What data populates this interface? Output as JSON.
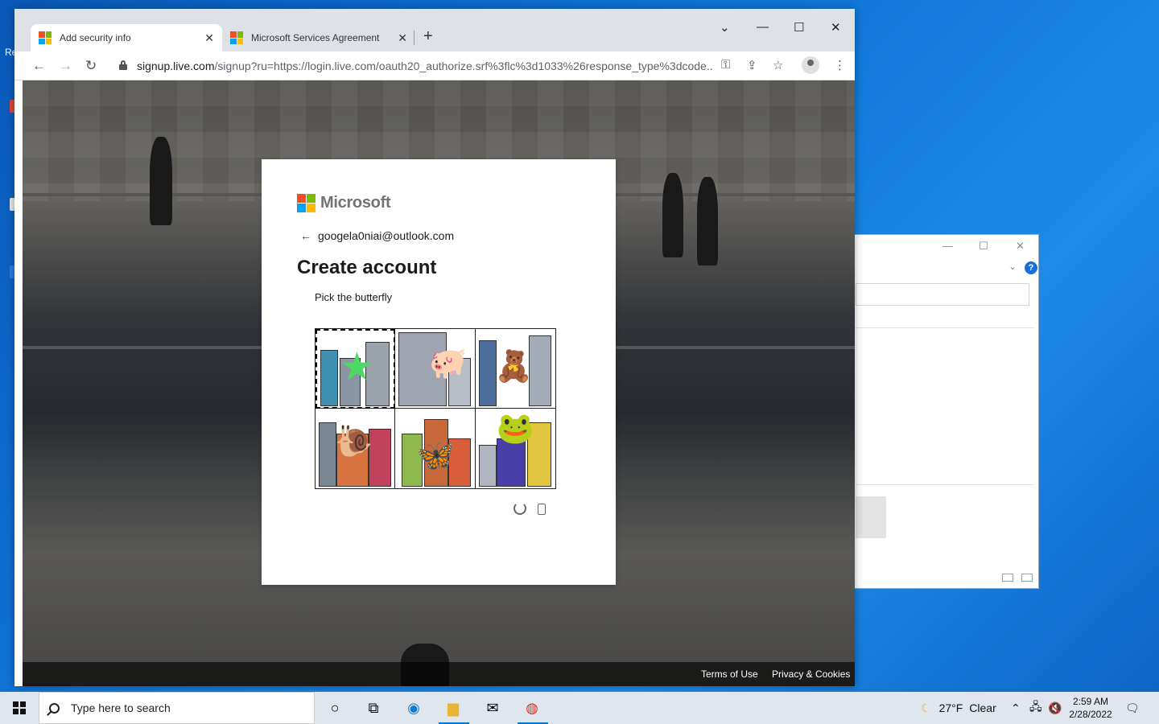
{
  "desktop": {
    "edge_text": "Re"
  },
  "browser": {
    "tabs": [
      {
        "title": "Add security info",
        "active": true
      },
      {
        "title": "Microsoft Services Agreement",
        "active": false
      }
    ],
    "url_host": "signup.live.com",
    "url_rest": "/signup?ru=https://login.live.com/oauth20_authorize.srf%3flc%3d1033%26response_type%3dcode..."
  },
  "card": {
    "brand": "Microsoft",
    "email": "googela0niai@outlook.com",
    "heading": "Create account",
    "instruction": "Pick the butterfly"
  },
  "captcha": {
    "tiles": [
      {
        "subject": "starfish",
        "icon": "★",
        "color": "#4cd964"
      },
      {
        "subject": "pig",
        "icon": "🐖",
        "color": "#f2a0b0"
      },
      {
        "subject": "toy",
        "icon": "🧸",
        "color": "#f5e6a0"
      },
      {
        "subject": "snail",
        "icon": "🐌",
        "color": "#e86f6f"
      },
      {
        "subject": "butterfly",
        "icon": "🦋",
        "color": "#e5c25a"
      },
      {
        "subject": "frog",
        "icon": "🐸",
        "color": "#6fcf4a"
      }
    ],
    "focused_tile": 0
  },
  "footer": {
    "terms": "Terms of Use",
    "privacy": "Privacy & Cookies"
  },
  "taskbar": {
    "search_placeholder": "Type here to search",
    "weather": "27°F",
    "weather_desc": "Clear",
    "time": "2:59 AM",
    "date": "2/28/2022"
  },
  "colors": {
    "ms_red": "#f25022",
    "ms_green": "#7fba00",
    "ms_blue": "#00a4ef",
    "ms_yellow": "#ffb900",
    "accent": "#0078d4"
  }
}
